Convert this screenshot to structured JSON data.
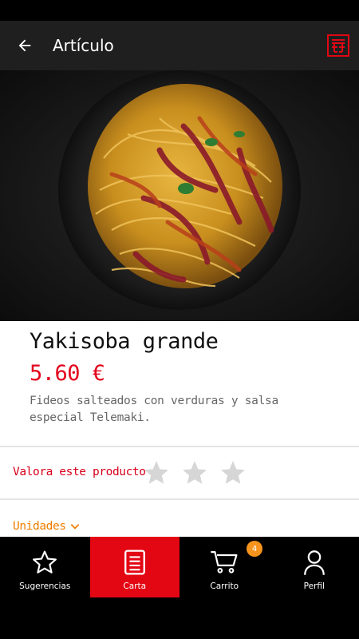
{
  "header": {
    "title": "Artículo",
    "back_icon": "arrow-left-icon",
    "logo_icon": "telemaki-logo-icon"
  },
  "product": {
    "name": "Yakisoba grande",
    "price": "5.60 €",
    "description": "Fideos salteados con verduras y salsa especial Telemaki."
  },
  "rating": {
    "label": "Valora este producto",
    "stars": 3,
    "value": 0
  },
  "units": {
    "label": "Unidades"
  },
  "nav": {
    "items": [
      {
        "label": "Sugerencias",
        "icon": "star-outline-icon"
      },
      {
        "label": "Carta",
        "icon": "menu-list-icon"
      },
      {
        "label": "Carrito",
        "icon": "cart-icon"
      },
      {
        "label": "Perfil",
        "icon": "person-icon"
      }
    ],
    "cart_badge": "4"
  },
  "colors": {
    "accent_red": "#e30613",
    "price_red": "#e3001b",
    "units_orange": "#ef7d00",
    "badge_orange": "#f7941d"
  }
}
